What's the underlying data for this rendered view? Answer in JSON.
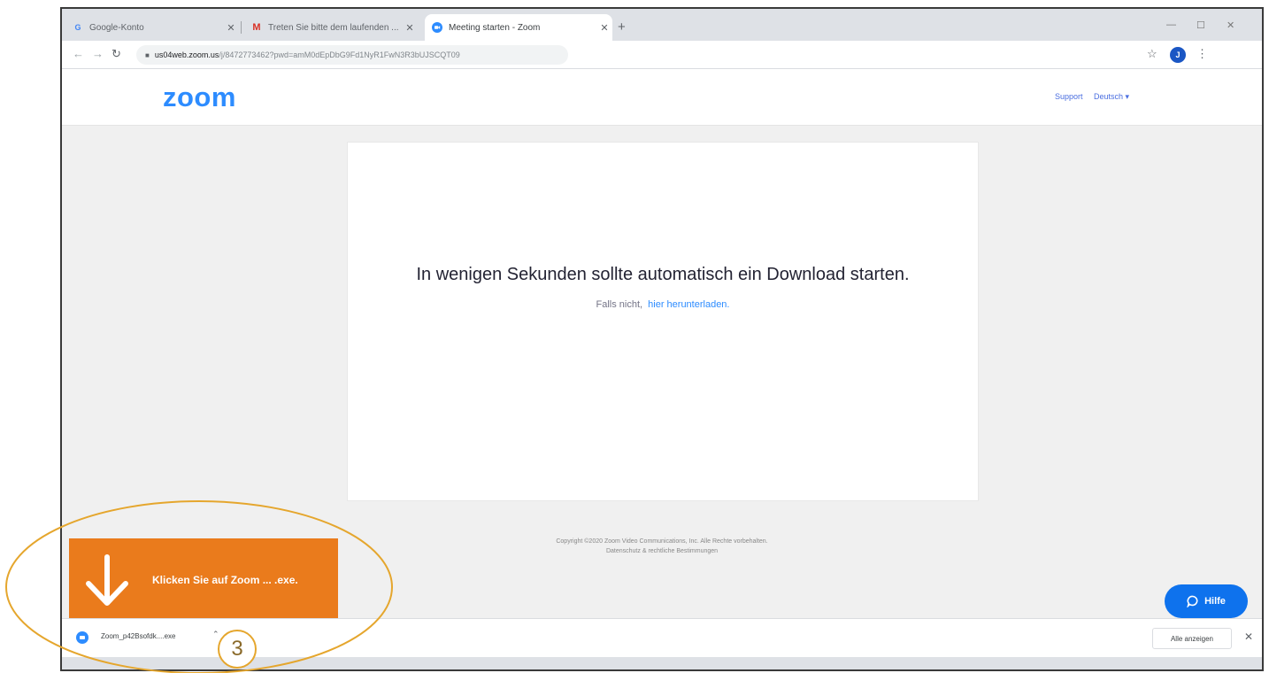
{
  "browser": {
    "tabs": [
      {
        "label": "Google-Konto",
        "favicon": "G"
      },
      {
        "label": "Treten Sie bitte dem laufenden ...",
        "favicon": "M"
      },
      {
        "label": "Meeting starten - Zoom",
        "favicon": "zoom"
      }
    ],
    "new_tab": "+",
    "url_host": "us04web.zoom.us",
    "url_path": "/j/8472773462?pwd=amM0dEpDbG9Fd1NyR1FwN3R3bUJSCQT09",
    "profile_initial": "J"
  },
  "page": {
    "logo": "zoom",
    "support": "Support",
    "language": "Deutsch ▾",
    "message": "In wenigen Sekunden sollte automatisch ein Download starten.",
    "fallback_prefix": "Falls nicht,",
    "fallback_link": "hier herunterladen.",
    "footer_line1": "Copyright ©2020 Zoom Video Communications, Inc. Alle Rechte vorbehalten.",
    "footer_line2": "Datenschutz & rechtliche Bestimmungen",
    "help_button": "Hilfe"
  },
  "callout": {
    "text": "Klicken Sie auf Zoom ... .exe.",
    "step": "3"
  },
  "shelf": {
    "file": "Zoom_p42Bsofdk....exe",
    "show_all": "Alle anzeigen",
    "close": "✕"
  },
  "colors": {
    "zoom_blue": "#2d8cff",
    "callout_orange": "#ea7b1c",
    "annotation_gold": "#e5a62d"
  }
}
